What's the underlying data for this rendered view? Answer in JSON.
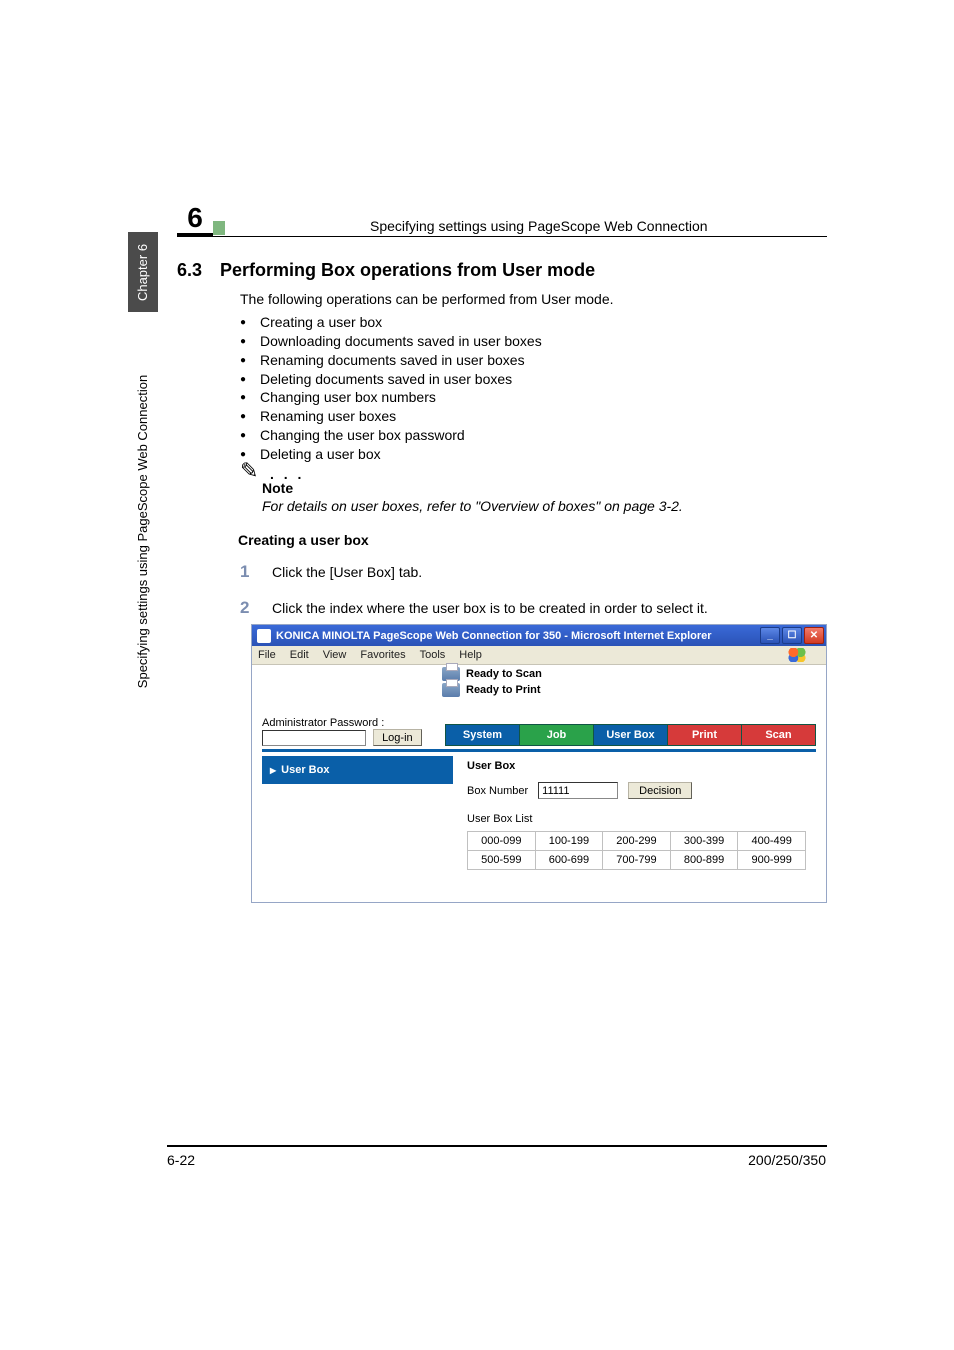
{
  "sidebar": {
    "chapter_label": "Chapter 6",
    "vertical_title": "Specifying settings using PageScope Web Connection"
  },
  "header": {
    "chapter_num": "6",
    "running_title": "Specifying settings using PageScope Web Connection"
  },
  "section": {
    "number": "6.3",
    "title": "Performing Box operations from User mode",
    "intro": "The following operations can be performed from User mode.",
    "bullets": [
      "Creating a user box",
      "Downloading documents saved in user boxes",
      "Renaming documents saved in user boxes",
      "Deleting documents saved in user boxes",
      "Changing user box numbers",
      "Renaming user boxes",
      "Changing the user box password",
      "Deleting a user box"
    ],
    "note_label": "Note",
    "note_text": "For details on user boxes, refer to \"Overview of boxes\" on page 3-2.",
    "subheading": "Creating a user box",
    "step1": "Click the [User Box] tab.",
    "step2": "Click the index where the user box is to be created in order to select it."
  },
  "screenshot": {
    "window_title": "KONICA MINOLTA PageScope Web Connection for 350 - Microsoft Internet Explorer",
    "menu": {
      "file": "File",
      "edit": "Edit",
      "view": "View",
      "favorites": "Favorites",
      "tools": "Tools",
      "help": "Help"
    },
    "status_scan": "Ready to Scan",
    "status_print": "Ready to Print",
    "admin_label": "Administrator Password :",
    "login_btn": "Log-in",
    "tabs": {
      "system": "System",
      "job": "Job",
      "userbox": "User Box",
      "print": "Print",
      "scan": "Scan"
    },
    "left_nav_item": "User Box",
    "panel_title": "User Box",
    "box_number_label": "Box Number",
    "box_number_value": "11111",
    "decision_btn": "Decision",
    "list_label": "User Box List",
    "index_pages": [
      [
        "000-099",
        "100-199",
        "200-299",
        "300-399",
        "400-499"
      ],
      [
        "500-599",
        "600-699",
        "700-799",
        "800-899",
        "900-999"
      ]
    ]
  },
  "footer": {
    "left": "6-22",
    "right": "200/250/350"
  }
}
